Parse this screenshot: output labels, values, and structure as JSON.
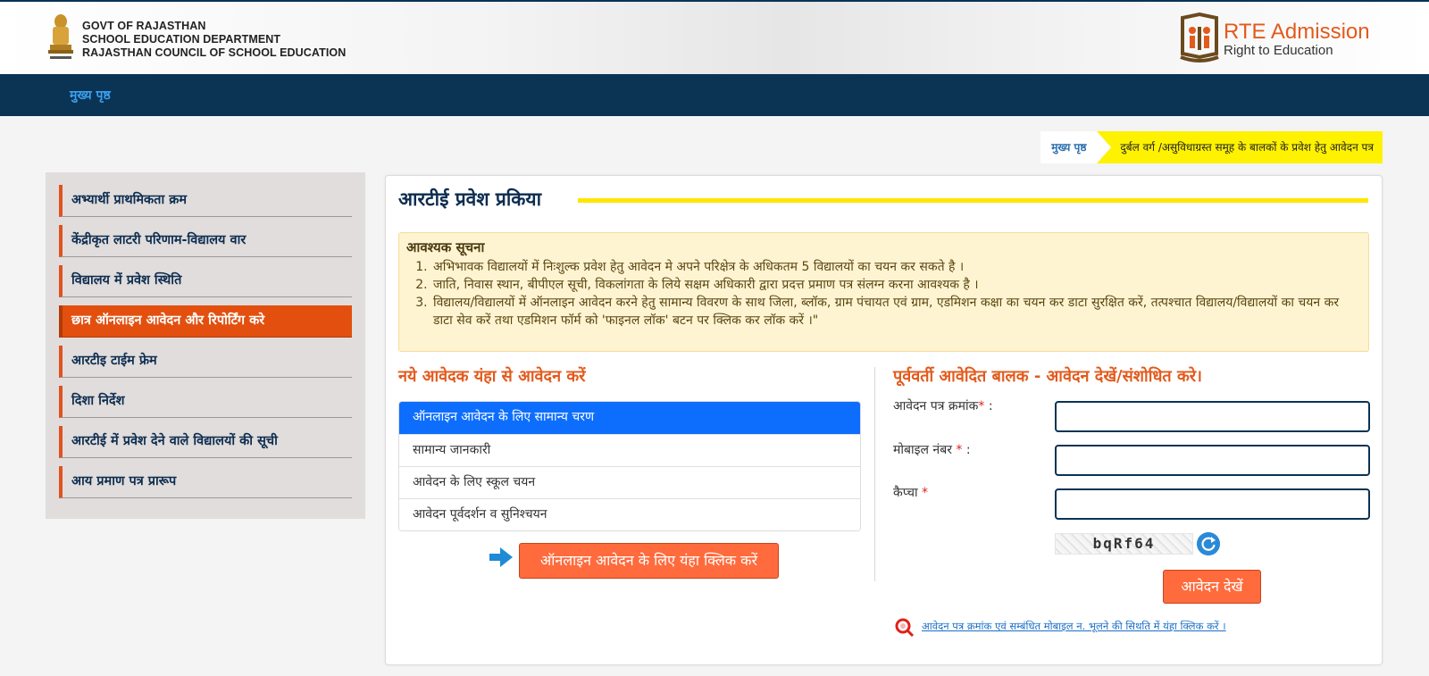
{
  "header": {
    "line1": "GOVT OF RAJASTHAN",
    "line2": "SCHOOL EDUCATION DEPARTMENT",
    "line3": "RAJASTHAN COUNCIL OF SCHOOL EDUCATION",
    "rte_title": "RTE Admission",
    "rte_subtitle": "Right to Education"
  },
  "nav": {
    "home": "मुख्य पृष्ठ"
  },
  "breadcrumb": {
    "home": "मुख्य पृष्ठ",
    "current": "दुर्बल वर्ग /असुविधाग्रस्त समूह के बालकों के प्रवेश हेतु आवेदन पत्र"
  },
  "sidebar": {
    "items": [
      {
        "label": "अभ्यार्थी प्राथमिकता क्रम"
      },
      {
        "label": "केंद्रीकृत लाटरी परिणाम-विद्यालय वार"
      },
      {
        "label": "विद्यालय में प्रवेश स्थिति"
      },
      {
        "label": "छात्र ऑनलाइन आवेदन और रिपोर्टिंग करे"
      },
      {
        "label": "आरटीइ टाईम फ्रेम"
      },
      {
        "label": "दिशा निर्देश"
      },
      {
        "label": "आरटीई में प्रवेश देने वाले विद्यालयों की सूची"
      },
      {
        "label": "आय प्रमाण पत्र प्रारूप"
      }
    ]
  },
  "main": {
    "title": "आरटीई प्रवेश प्रकिया",
    "notice": {
      "heading": "आवश्यक सूचना",
      "items": [
        "अभिभावक विद्यालयों में निःशुल्क प्रवेश हेतु आवेदन मे अपने परिक्षेत्र के अधिकतम 5 विद्यालयों का चयन कर सकते है ।",
        "जाति, निवास स्थान, बीपीएल सूची, विकलांगता के लिये सक्षम अधिकारी द्वारा प्रदत्त प्रमाण पत्र संलग्न करना आवश्यक है ।",
        "विद्यालय/विद्यालयों में ऑनलाइन आवेदन करने हेतु सामान्य विवरण के साथ जिला, ब्लॉक, ग्राम पंचायत एवं ग्राम, एडमिशन कक्षा का चयन कर डाटा सुरक्षित करें, तत्पश्चात विद्यालय/विद्यालयों का चयन कर डाटा सेव करें तथा एडमिशन फॉर्म को 'फाइनल लॉक' बटन पर क्लिक कर लॉक करें ।\""
      ]
    },
    "new_applicant": {
      "heading": "नये आवेदक यंहा से आवेदन करें",
      "steps": [
        "ऑनलाइन आवेदन के लिए सामान्य चरण",
        "सामान्य जानकारी",
        "आवेदन के लिए स्कूल चयन",
        "आवेदन पूर्वदर्शन व सुनिश्चयन"
      ],
      "apply_button": "ऑनलाइन आवेदन के लिए यंहा क्लिक करें"
    },
    "previous": {
      "heading": "पूर्ववर्ती आवेदित बालक - आवेदन देखें/संशोधित करे।",
      "application_label": "आवेदन पत्र क्रमांक",
      "mobile_label": "मोबाइल नंबर ",
      "captcha_label": "कैप्चा ",
      "required_mark": "*",
      "colon": " :",
      "captcha_text": "bqRf64",
      "view_button": "आवेदन देखें",
      "help_link": "आवेदन पत्र क्रमांक एवं सम्बंधित मोबाइल न. भूलने की सिथति में यंहा क्लिक करें ।"
    }
  },
  "colors": {
    "navy": "#0a3354",
    "orange": "#e25a1c",
    "button_orange": "#ff6b3d",
    "yellow": "#ffe600",
    "active_blue": "#0d6efd"
  }
}
